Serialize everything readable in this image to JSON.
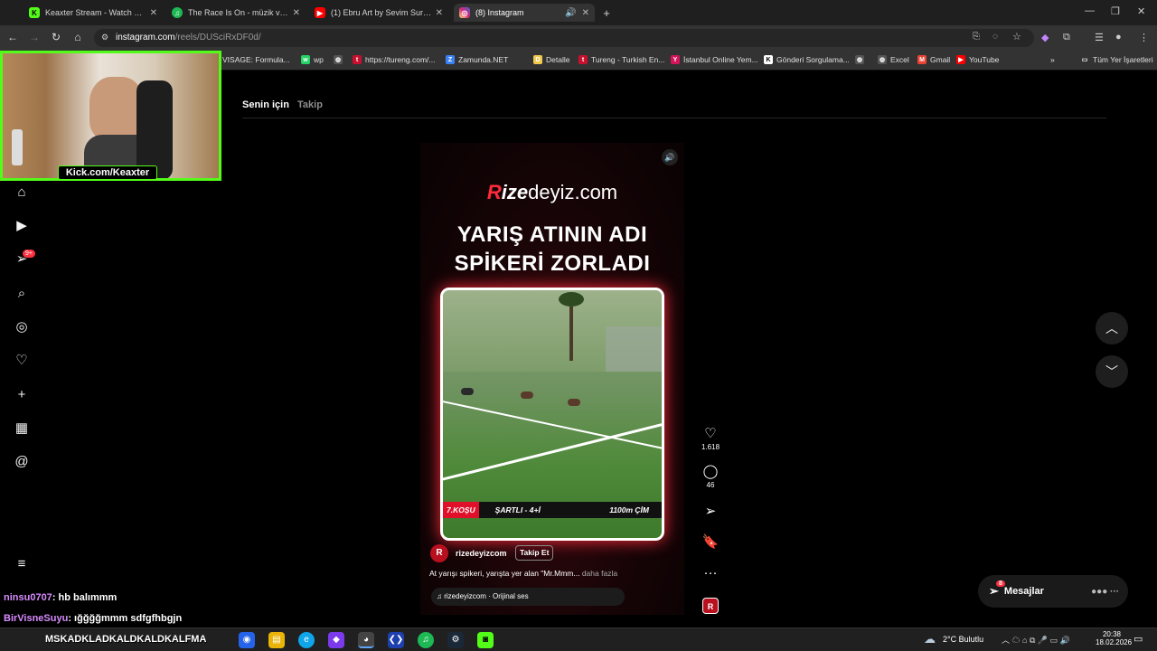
{
  "tabs": [
    {
      "label": "Keaxter Stream - Watch Live on",
      "fav_color": "#53fc18",
      "fav_glyph": "K"
    },
    {
      "label": "The Race Is On - müzik ve şarkı",
      "fav_color": "#1db954",
      "fav_glyph": "♫"
    },
    {
      "label": "(1) Ebru Art by Sevim Surucu - Y",
      "fav_color": "#ff0000",
      "fav_glyph": "▶"
    },
    {
      "label": "(8) Instagram",
      "fav_color": "#d6249f",
      "fav_glyph": "◎"
    }
  ],
  "address": {
    "host": "instagram.com",
    "path": "/reels/DUSciRxDF0d/"
  },
  "bookmarks": [
    {
      "label": "VISAGE: Formula...",
      "color": "#666",
      "glyph": ""
    },
    {
      "label": "wp",
      "color": "#25d366",
      "glyph": "w"
    },
    {
      "label": "",
      "color": "#555",
      "glyph": "◍"
    },
    {
      "label": "https://tureng.com/...",
      "color": "#c8102e",
      "glyph": "t"
    },
    {
      "label": "Zamunda.NET",
      "color": "#3b82f6",
      "glyph": "Z"
    },
    {
      "label": "Detalle",
      "color": "#f2c94c",
      "glyph": "D"
    },
    {
      "label": "Tureng - Turkish En...",
      "color": "#c8102e",
      "glyph": "t"
    },
    {
      "label": "İstanbul Online Yem...",
      "color": "#d4145a",
      "glyph": "Y"
    },
    {
      "label": "Gönderi Sorgulama...",
      "color": "#fff",
      "glyph": "K"
    },
    {
      "label": "",
      "color": "#555",
      "glyph": "◍"
    },
    {
      "label": "Excel",
      "color": "#555",
      "glyph": "◍"
    },
    {
      "label": "Gmail",
      "color": "#ea4335",
      "glyph": "M"
    },
    {
      "label": "YouTube",
      "color": "#ff0000",
      "glyph": "▶"
    },
    {
      "label": "»",
      "color": "transparent",
      "glyph": ""
    },
    {
      "label": "Tüm Yer İşaretleri",
      "color": "transparent",
      "glyph": "▭"
    }
  ],
  "feed": {
    "tab_for_you": "Senin için",
    "tab_following": "Takip"
  },
  "reel": {
    "brand_prefix": "R",
    "brand_bold": "ize",
    "brand_rest": "deyiz.com",
    "headline_line1": "YARIŞ ATININ ADI",
    "headline_line2": "SPİKERİ ZORLADI",
    "bar_race": "7.KOŞU",
    "bar_condition": "ŞARTLI - 4+İ",
    "bar_distance": "1100m  ÇİM",
    "author": "rizedeyizcom",
    "follow": "Takip Et",
    "caption": "At yarışı spikeri, yarışta yer alan \"Mr.Mmm...",
    "more": "daha fazla",
    "audio": "rizedeyizcom · Orijinal ses"
  },
  "actions": {
    "likes": "1.618",
    "comments": "46"
  },
  "notification_badge": "9+",
  "messages": {
    "label": "Mesajlar",
    "badge": "8"
  },
  "stream": {
    "channel": "Kick.com/Keaxter"
  },
  "chat": [
    {
      "user": "ninsu0707",
      "text": ": hb balımmm",
      "color": "#d88bff"
    },
    {
      "user": "BirVisneSuyu",
      "text": ": ığğğğmmm sdfgfhbgjn",
      "color": "#d88bff"
    },
    {
      "user": "",
      "text": "MSKADKLADKALDKALDKALFMA",
      "color": "#ffffff"
    }
  ],
  "taskbar": {
    "weather": "2°C  Bulutlu",
    "time": "20:38",
    "date": "18.02.2026"
  }
}
